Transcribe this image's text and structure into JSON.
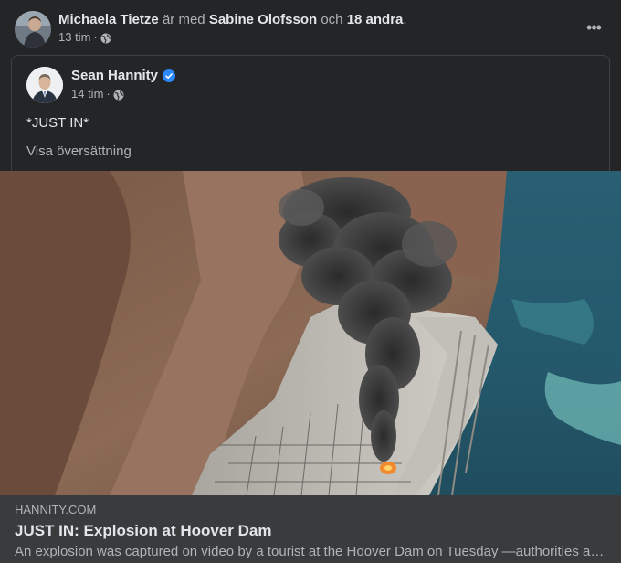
{
  "post": {
    "author": "Michaela Tietze",
    "with_text": "är med",
    "tagged_person": "Sabine Olofsson",
    "and_text": "och",
    "others": "18 andra",
    "period": ".",
    "time": "13 tim",
    "separator": "·",
    "privacy_icon": "globe-icon",
    "more_label": "•••"
  },
  "shared_post": {
    "author": "Sean Hannity",
    "verified_icon": "verified-badge-icon",
    "time": "14 tim",
    "separator": "·",
    "privacy_icon": "globe-icon",
    "text": "*JUST IN*",
    "translate": "Visa översättning"
  },
  "link_preview": {
    "domain": "HANNITY.COM",
    "title": "JUST IN: Explosion at Hoover Dam",
    "description": "An explosion was captured on video by a tourist at the Hoover Dam on Tuesday —authorities are investigating the incident."
  },
  "colors": {
    "background": "#242526",
    "text_primary": "#e4e6eb",
    "text_secondary": "#b0b3b8",
    "verified": "#2d88ff",
    "preview_bg": "#3a3b3c"
  }
}
